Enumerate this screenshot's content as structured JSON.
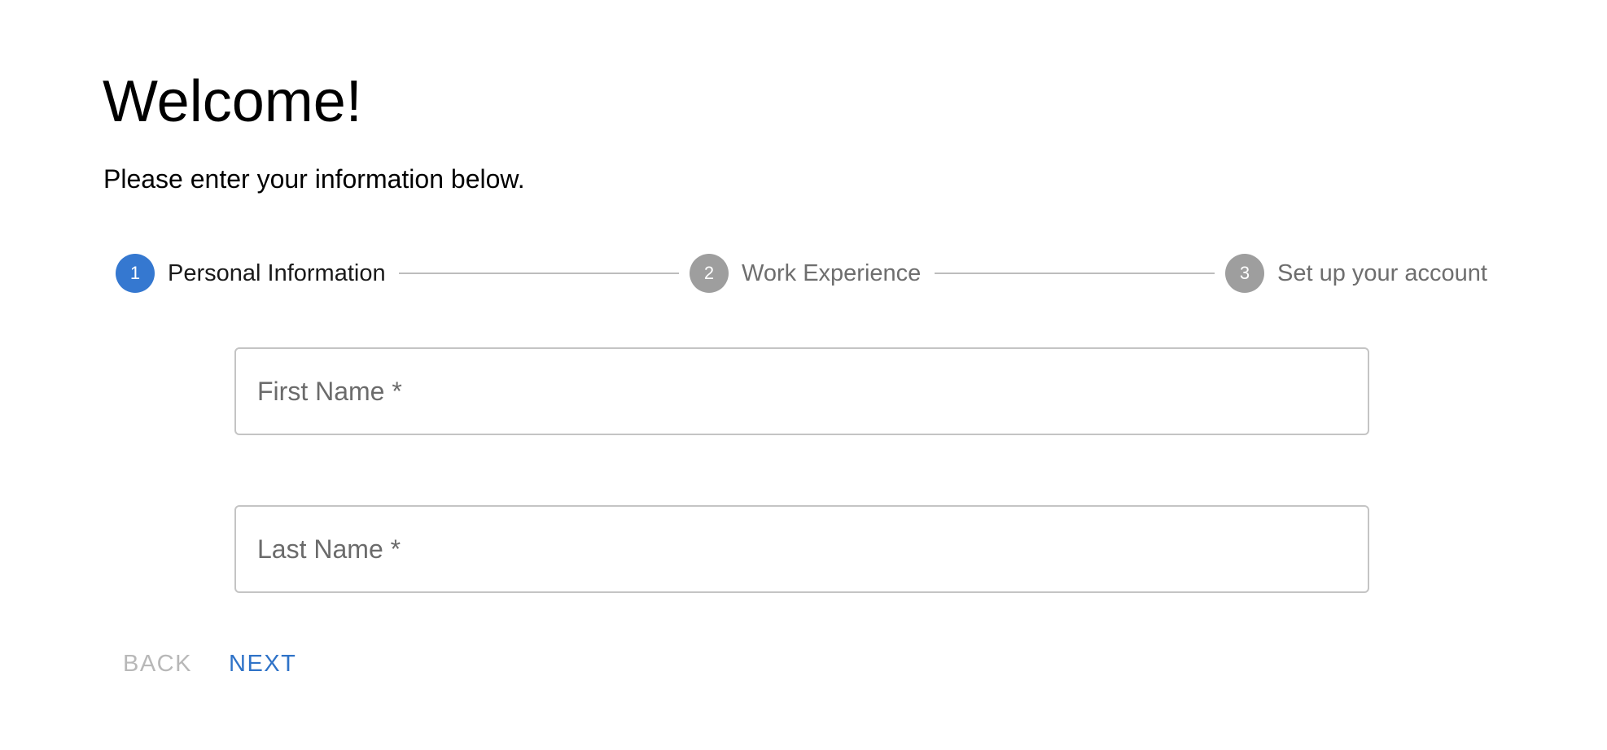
{
  "header": {
    "title": "Welcome!",
    "subtitle": "Please enter your information below."
  },
  "stepper": {
    "active_step": 1,
    "steps": [
      {
        "number": "1",
        "label": "Personal Information",
        "state": "active"
      },
      {
        "number": "2",
        "label": "Work Experience",
        "state": "inactive"
      },
      {
        "number": "3",
        "label": "Set up your account",
        "state": "inactive"
      }
    ]
  },
  "form": {
    "first_name": {
      "placeholder": "First Name *",
      "value": ""
    },
    "last_name": {
      "placeholder": "Last Name *",
      "value": ""
    }
  },
  "actions": {
    "back_label": "BACK",
    "back_disabled": true,
    "next_label": "NEXT"
  },
  "colors": {
    "accent": "#3578d0",
    "inactive_step": "#9e9e9e",
    "disabled_text": "#b8b8b8",
    "link_button": "#2f73c8"
  }
}
